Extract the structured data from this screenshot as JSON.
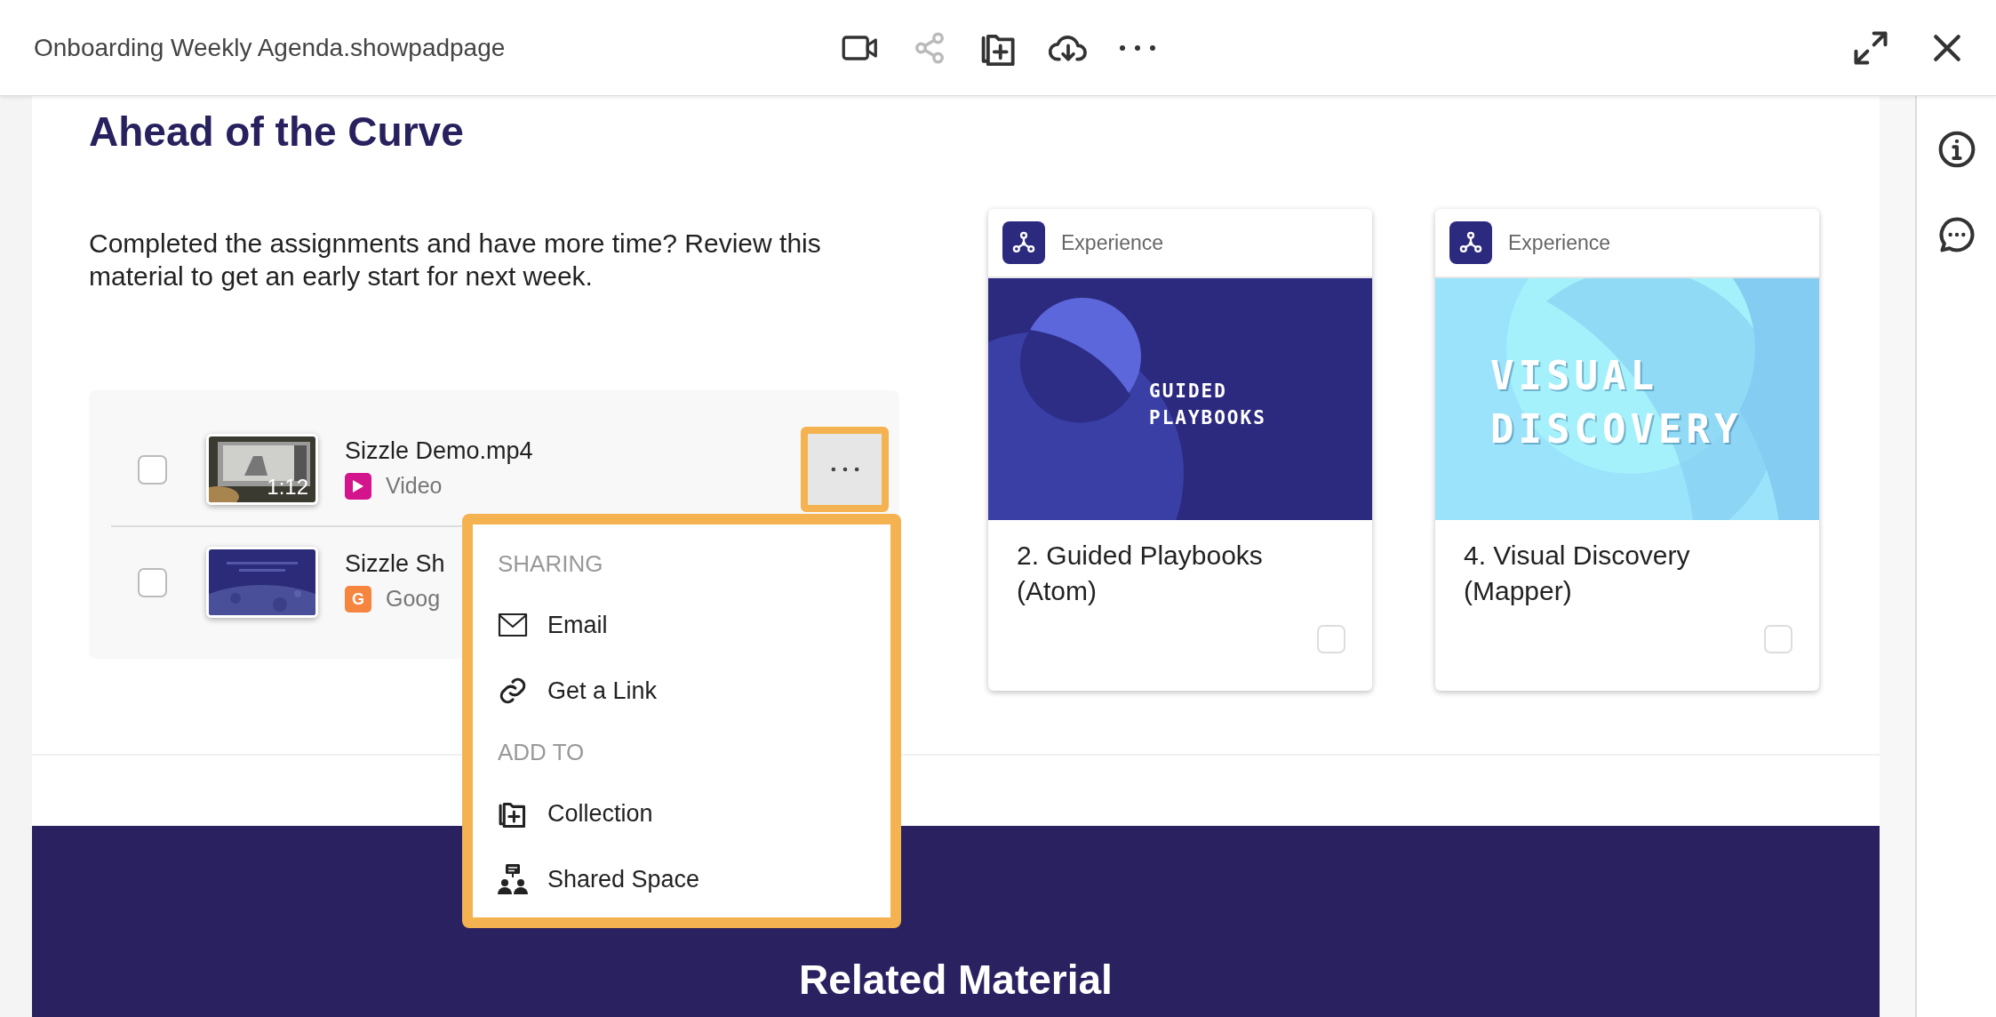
{
  "header": {
    "title": "Onboarding Weekly Agenda.showpadpage",
    "toolbar": [
      {
        "kind": "video",
        "disabled": false
      },
      {
        "kind": "share",
        "disabled": true
      },
      {
        "kind": "collection",
        "disabled": false
      },
      {
        "kind": "download",
        "disabled": false
      },
      {
        "kind": "more",
        "disabled": false
      }
    ],
    "window_controls": [
      {
        "kind": "expand"
      },
      {
        "kind": "close"
      }
    ]
  },
  "section": {
    "heading": "Ahead of the Curve",
    "description": "Completed the assignments and have more time? Review this material to get an early start for next week.",
    "items": [
      {
        "kind": "video",
        "title": "Sizzle Demo.mp4",
        "type_label": "Video",
        "duration": "1:12",
        "checked": false,
        "more_button": true
      },
      {
        "kind": "slides",
        "title": "Sizzle Sh",
        "type_label": "Goog",
        "type_glyph": "G",
        "checked": false,
        "more_button": false
      }
    ],
    "menu": {
      "highlighted": true,
      "groups": [
        {
          "heading": "SHARING",
          "items": [
            {
              "kind": "email",
              "label": "Email"
            },
            {
              "kind": "link",
              "label": "Get a Link"
            }
          ]
        },
        {
          "heading": "ADD TO",
          "items": [
            {
              "kind": "collection",
              "label": "Collection"
            },
            {
              "kind": "space",
              "label": "Shared Space"
            }
          ]
        }
      ]
    },
    "cards": [
      {
        "kind": "dark",
        "badge": "Experience",
        "image_lines": [
          "GUIDED",
          "PLAYBOOKS"
        ],
        "title_lines": [
          "2. Guided Playbooks",
          "(Atom)"
        ],
        "checked": false
      },
      {
        "kind": "light",
        "badge": "Experience",
        "image_lines": [
          "VISUAL",
          "DISCOVERY"
        ],
        "title_lines": [
          "4. Visual Discovery",
          "(Mapper)"
        ],
        "checked": false
      }
    ]
  },
  "related": {
    "heading": "Related Material"
  },
  "sidebar": [
    {
      "kind": "info"
    },
    {
      "kind": "comments"
    }
  ]
}
